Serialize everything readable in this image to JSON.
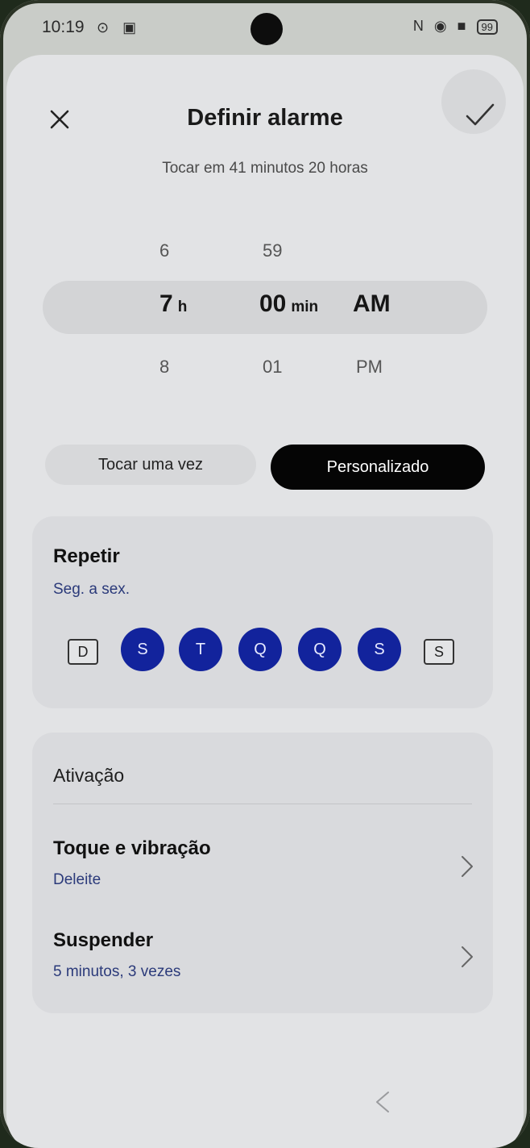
{
  "status": {
    "time": "10:19",
    "left_icons": "⊙ ▣",
    "right_icons": "N ◉ ■",
    "battery": "99"
  },
  "header": {
    "title": "Definir alarme",
    "subtitle": "Tocar em 41 minutos 20 horas"
  },
  "picker": {
    "hour_prev": "6",
    "hour_selected": "7",
    "hour_next": "8",
    "hour_unit": "h",
    "minute_prev": "59",
    "minute_selected": "00",
    "minute_next": "01",
    "minute_unit": "min",
    "ampm_selected": "AM",
    "ampm_next": "PM"
  },
  "mode": {
    "once_label": "Tocar uma vez",
    "custom_label": "Personalizado",
    "selected": "custom"
  },
  "repeat": {
    "title": "Repetir",
    "summary": "Seg. a sex.",
    "days": [
      {
        "label": "D",
        "active": false
      },
      {
        "label": "S",
        "active": true
      },
      {
        "label": "T",
        "active": true
      },
      {
        "label": "Q",
        "active": true
      },
      {
        "label": "Q",
        "active": true
      },
      {
        "label": "S",
        "active": true
      },
      {
        "label": "S",
        "active": false
      }
    ]
  },
  "activation": {
    "section_title": "Ativação",
    "ring": {
      "title": "Toque e vibração",
      "value": "Deleite"
    },
    "snooze": {
      "title": "Suspender",
      "value": "5 minutos, 3 vezes"
    }
  },
  "colors": {
    "accent_day": "#12239c",
    "selected_mode_bg": "#050505",
    "sheet_bg": "#e2e3e5"
  },
  "icons": {
    "close": "close-icon",
    "confirm": "check-icon",
    "chevron": "chevron-right-icon",
    "nav": "back-icon"
  }
}
